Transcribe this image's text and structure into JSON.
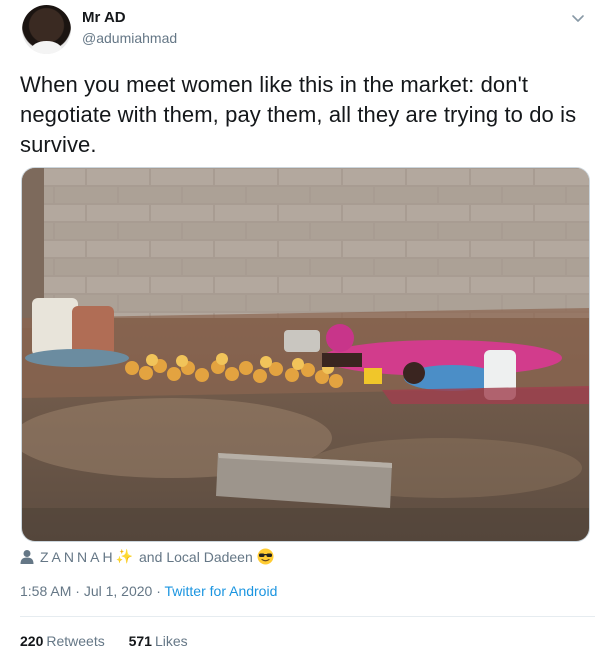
{
  "author": {
    "name": "Mr AD",
    "handle": "@adumiahmad"
  },
  "tweet": {
    "text": "When you meet women like this in the market: don't negotiate with them, pay them, all they are trying to do is survive."
  },
  "likers": {
    "first": "ZANNAH",
    "connector": "and",
    "second": "Local Dadeen"
  },
  "meta": {
    "time": "1:58 AM",
    "separator1": " · ",
    "date": "Jul 1, 2020",
    "separator2": " · ",
    "source": "Twitter for Android"
  },
  "stats": {
    "retweets_count": "220",
    "retweets_label": "Retweets",
    "likes_count": "571",
    "likes_label": "Likes"
  },
  "colors": {
    "link": "#1b95e0",
    "secondary": "#657786",
    "text": "#14171a"
  }
}
